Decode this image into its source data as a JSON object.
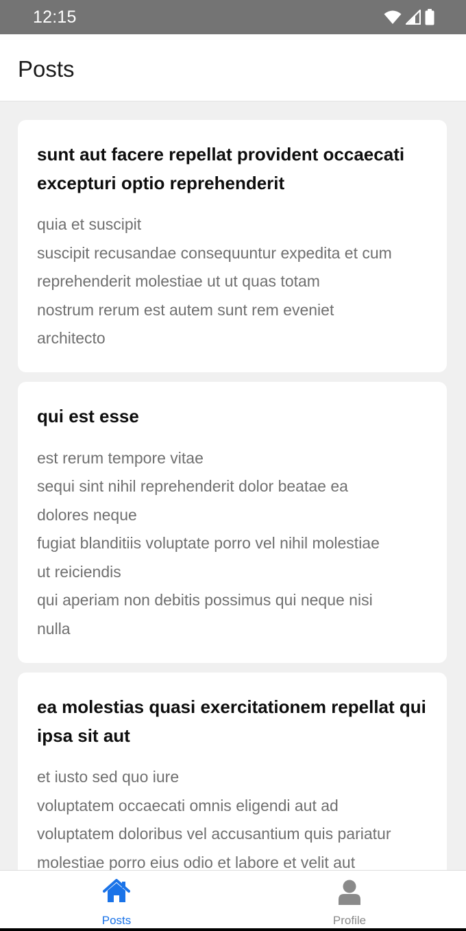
{
  "status_bar": {
    "time": "12:15",
    "icons": [
      "wifi-icon",
      "cellular-signal-icon",
      "battery-icon"
    ]
  },
  "header": {
    "title": "Posts"
  },
  "posts": [
    {
      "title": "sunt aut facere repellat provident occaecati excepturi optio reprehenderit",
      "body_lines": [
        "quia et suscipit",
        "suscipit recusandae consequuntur expedita et cum",
        "reprehenderit molestiae ut ut quas totam",
        "nostrum rerum est autem sunt rem eveniet",
        "architecto"
      ]
    },
    {
      "title": "qui est esse",
      "body_lines": [
        "est rerum tempore vitae",
        "sequi sint nihil reprehenderit dolor beatae ea",
        "dolores neque",
        "fugiat blanditiis voluptate porro vel nihil molestiae",
        "ut reiciendis",
        "qui aperiam non debitis possimus qui neque nisi",
        "nulla"
      ]
    },
    {
      "title": "ea molestias quasi exercitationem repellat qui ipsa sit aut",
      "body_lines": [
        "et iusto sed quo iure",
        "voluptatem occaecati omnis eligendi aut ad",
        "voluptatem doloribus vel accusantium quis pariatur",
        "molestiae porro eius odio et labore et velit aut"
      ]
    }
  ],
  "tabs": [
    {
      "label": "Posts",
      "icon": "home-icon",
      "active": true
    },
    {
      "label": "Profile",
      "icon": "user-icon",
      "active": false
    }
  ],
  "colors": {
    "status_bar": "#747474",
    "accent": "#1a73e8",
    "inactive": "#8a8a8a",
    "background": "#f0f0f0",
    "card": "#ffffff"
  }
}
